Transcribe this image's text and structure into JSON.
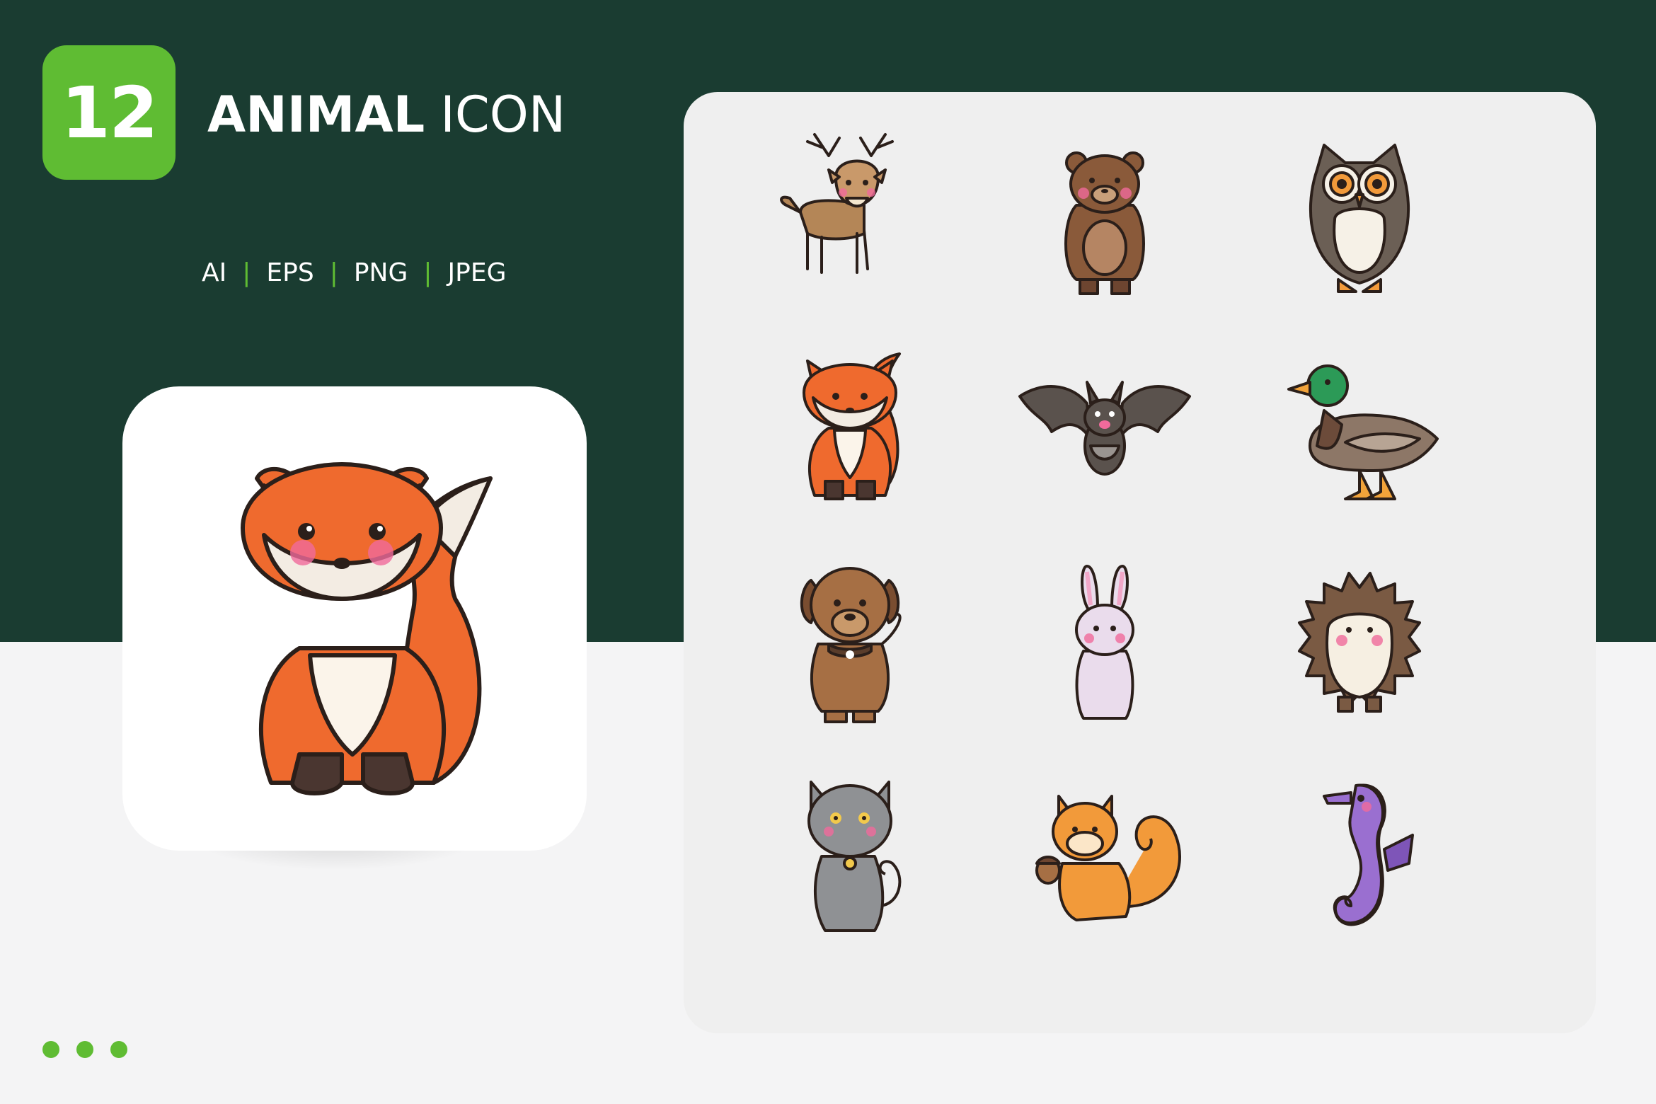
{
  "badge": {
    "count": "12"
  },
  "title": {
    "bold": "ANIMAL",
    "light": "ICON"
  },
  "formats": [
    "AI",
    "EPS",
    "PNG",
    "JPEG"
  ],
  "format_separator": "|",
  "hero": {
    "animal": "fox"
  },
  "grid": {
    "icons": [
      "deer",
      "bear",
      "owl",
      "fox",
      "bat",
      "duck",
      "dog",
      "rabbit",
      "hedgehog",
      "cat",
      "squirrel",
      "seahorse"
    ]
  },
  "pager": {
    "dots": 3
  },
  "colors": {
    "background_top": "#1a3c31",
    "background_bottom": "#f4f4f5",
    "accent": "#5fbc33",
    "card": "#ffffff",
    "grid_card": "#efefef"
  }
}
